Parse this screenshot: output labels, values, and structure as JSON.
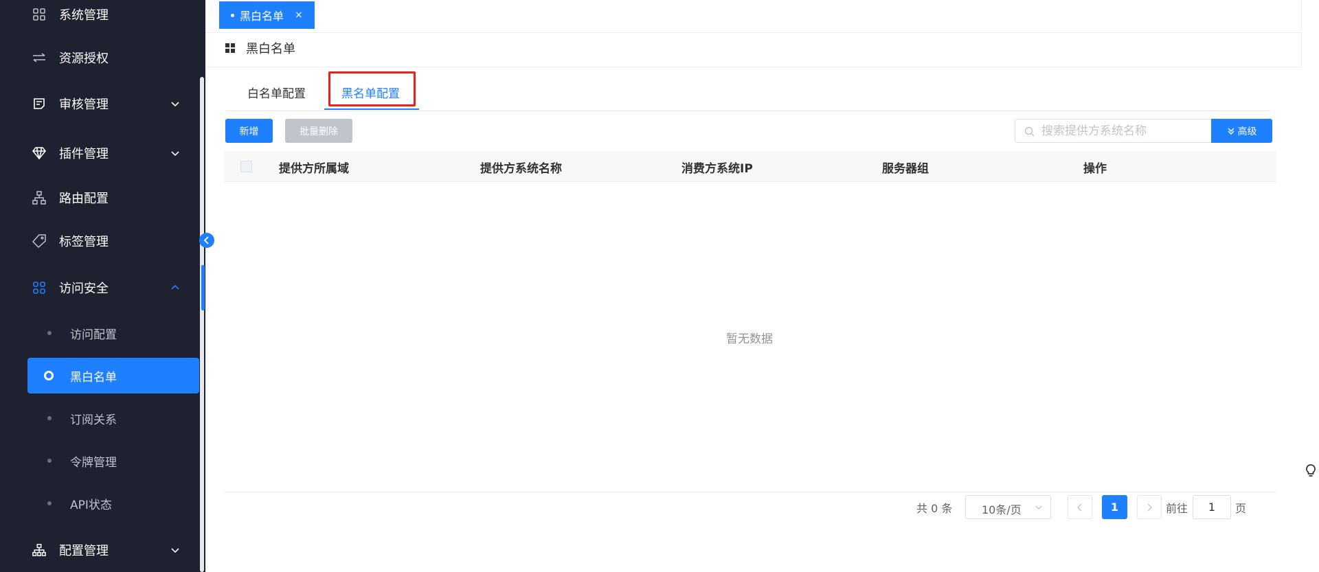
{
  "sidebar": {
    "items": [
      {
        "label": "系统管理",
        "icon": "grid-icon"
      },
      {
        "label": "资源授权",
        "icon": "transfer-icon"
      },
      {
        "label": "审核管理",
        "icon": "audit-icon",
        "expandable": true
      },
      {
        "label": "插件管理",
        "icon": "diamond-icon",
        "expandable": true
      },
      {
        "label": "路由配置",
        "icon": "route-icon"
      },
      {
        "label": "标签管理",
        "icon": "tag-icon"
      },
      {
        "label": "访问安全",
        "icon": "apps-icon",
        "expanded": true
      },
      {
        "label": "配置管理",
        "icon": "org-icon",
        "expandable": true
      }
    ],
    "sub_items": [
      {
        "label": "访问配置"
      },
      {
        "label": "黑白名单",
        "active": true
      },
      {
        "label": "订阅关系"
      },
      {
        "label": "令牌管理"
      },
      {
        "label": "API状态"
      }
    ]
  },
  "top_tab": {
    "label": "黑白名单",
    "close": "×"
  },
  "page": {
    "title": "黑白名单"
  },
  "tabs": [
    {
      "label": "白名单配置",
      "active": false
    },
    {
      "label": "黑名单配置",
      "active": true
    }
  ],
  "toolbar": {
    "add_label": "新增",
    "batch_delete_label": "批量删除",
    "search_placeholder": "搜索提供方系统名称",
    "search_value": "",
    "advanced_label": "高级"
  },
  "table": {
    "columns": [
      "提供方所属域",
      "提供方系统名称",
      "消费方系统IP",
      "服务器组",
      "操作"
    ],
    "rows": [],
    "empty_text": "暂无数据"
  },
  "pagination": {
    "total_text": "共 0 条",
    "page_size": "10条/页",
    "current_page": "1",
    "goto_label": "前往",
    "goto_value": "1",
    "page_suffix": "页"
  },
  "colors": {
    "sidebar_bg": "#1d2130",
    "accent": "#1e80ff",
    "highlight_border": "#e8231c"
  }
}
